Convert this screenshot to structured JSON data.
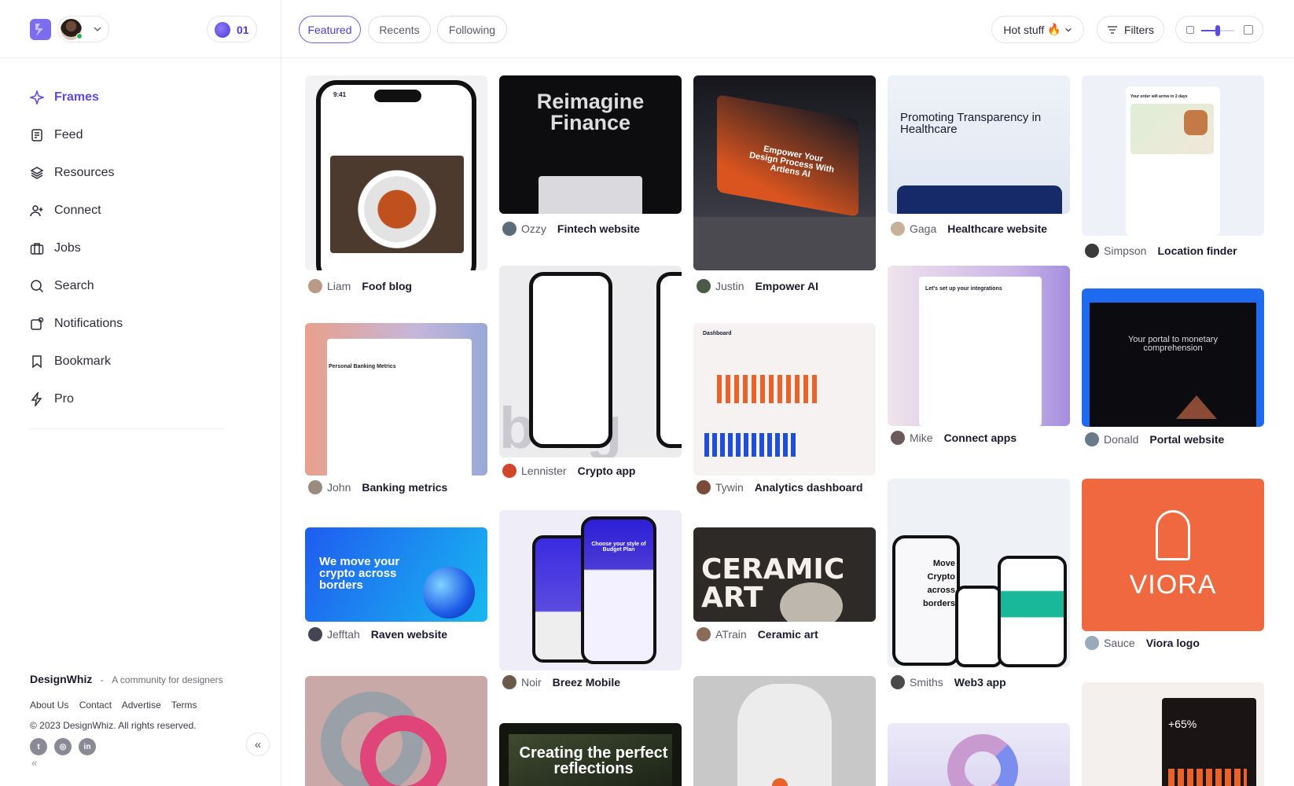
{
  "sidebar": {
    "credits": "01",
    "nav": [
      {
        "label": "Frames",
        "icon": "sparkle-icon",
        "active": true
      },
      {
        "label": "Feed",
        "icon": "feed-icon"
      },
      {
        "label": "Resources",
        "icon": "layers-icon"
      },
      {
        "label": "Connect",
        "icon": "user-plus-icon"
      },
      {
        "label": "Jobs",
        "icon": "briefcase-icon"
      },
      {
        "label": "Search",
        "icon": "search-icon"
      },
      {
        "label": "Notifications",
        "icon": "bell-icon"
      },
      {
        "label": "Bookmark",
        "icon": "bookmark-icon"
      },
      {
        "label": "Pro",
        "icon": "bolt-icon"
      }
    ],
    "footer": {
      "brand": "DesignWhiz",
      "separator": "-",
      "tagline": "A community for designers",
      "links": [
        "About Us",
        "Contact",
        "Advertise",
        "Terms"
      ],
      "copyright": "© 2023 DesignWhiz. All rights reserved."
    },
    "socials": [
      "twitter-icon",
      "instagram-icon",
      "linkedin-icon"
    ]
  },
  "topbar": {
    "tabs": [
      "Featured",
      "Recents",
      "Following"
    ],
    "sort": "Hot stuff",
    "filters": "Filters",
    "zoom_level": 0.5
  },
  "accent": "#5b4be0",
  "cards": [
    {
      "author": "Liam",
      "title": "Foof blog",
      "thumb_text": "9:41"
    },
    {
      "author": "John",
      "title": "Banking metrics",
      "thumb_text": "Personal Banking Metrics"
    },
    {
      "author": "Jefftah",
      "title": "Raven website",
      "thumb_text": "We move your crypto across borders"
    },
    {
      "author": "Ozzy",
      "title": "Fintech website",
      "thumb_text": "Reimagine Finance"
    },
    {
      "author": "Lennister",
      "title": "Crypto app",
      "thumb_text": "blog"
    },
    {
      "author": "Noir",
      "title": "Breez Mobile",
      "thumb_text": "Choose your style of Budget Plan"
    },
    {
      "author": "",
      "title": "",
      "thumb_text": "Creating the perfect reflections"
    },
    {
      "author": "Justin",
      "title": "Empower AI",
      "thumb_text": "Empower Your Design Process With Artlens AI"
    },
    {
      "author": "Tywin",
      "title": "Analytics dashboard",
      "thumb_text": "Dashboard"
    },
    {
      "author": "ATrain",
      "title": "Ceramic art",
      "thumb_text": "CERAMIC ART"
    },
    {
      "author": "Gaga",
      "title": "Healthcare website",
      "thumb_text": "Promoting Transparency in Healthcare"
    },
    {
      "author": "Mike",
      "title": "Connect apps",
      "thumb_text": "Let's set up your integrations"
    },
    {
      "author": "Smiths",
      "title": "Web3 app",
      "thumb_text": "Move Crypto across borders"
    },
    {
      "author": "Simpson",
      "title": "Location finder",
      "thumb_text": "Your order will arrive in 2 days"
    },
    {
      "author": "Donald",
      "title": "Portal website",
      "thumb_text": "Your portal to monetary comprehension"
    },
    {
      "author": "Sauce",
      "title": "Viora logo",
      "thumb_text": "VIORA"
    },
    {
      "author": "",
      "title": "",
      "thumb_text": "+65%"
    }
  ]
}
